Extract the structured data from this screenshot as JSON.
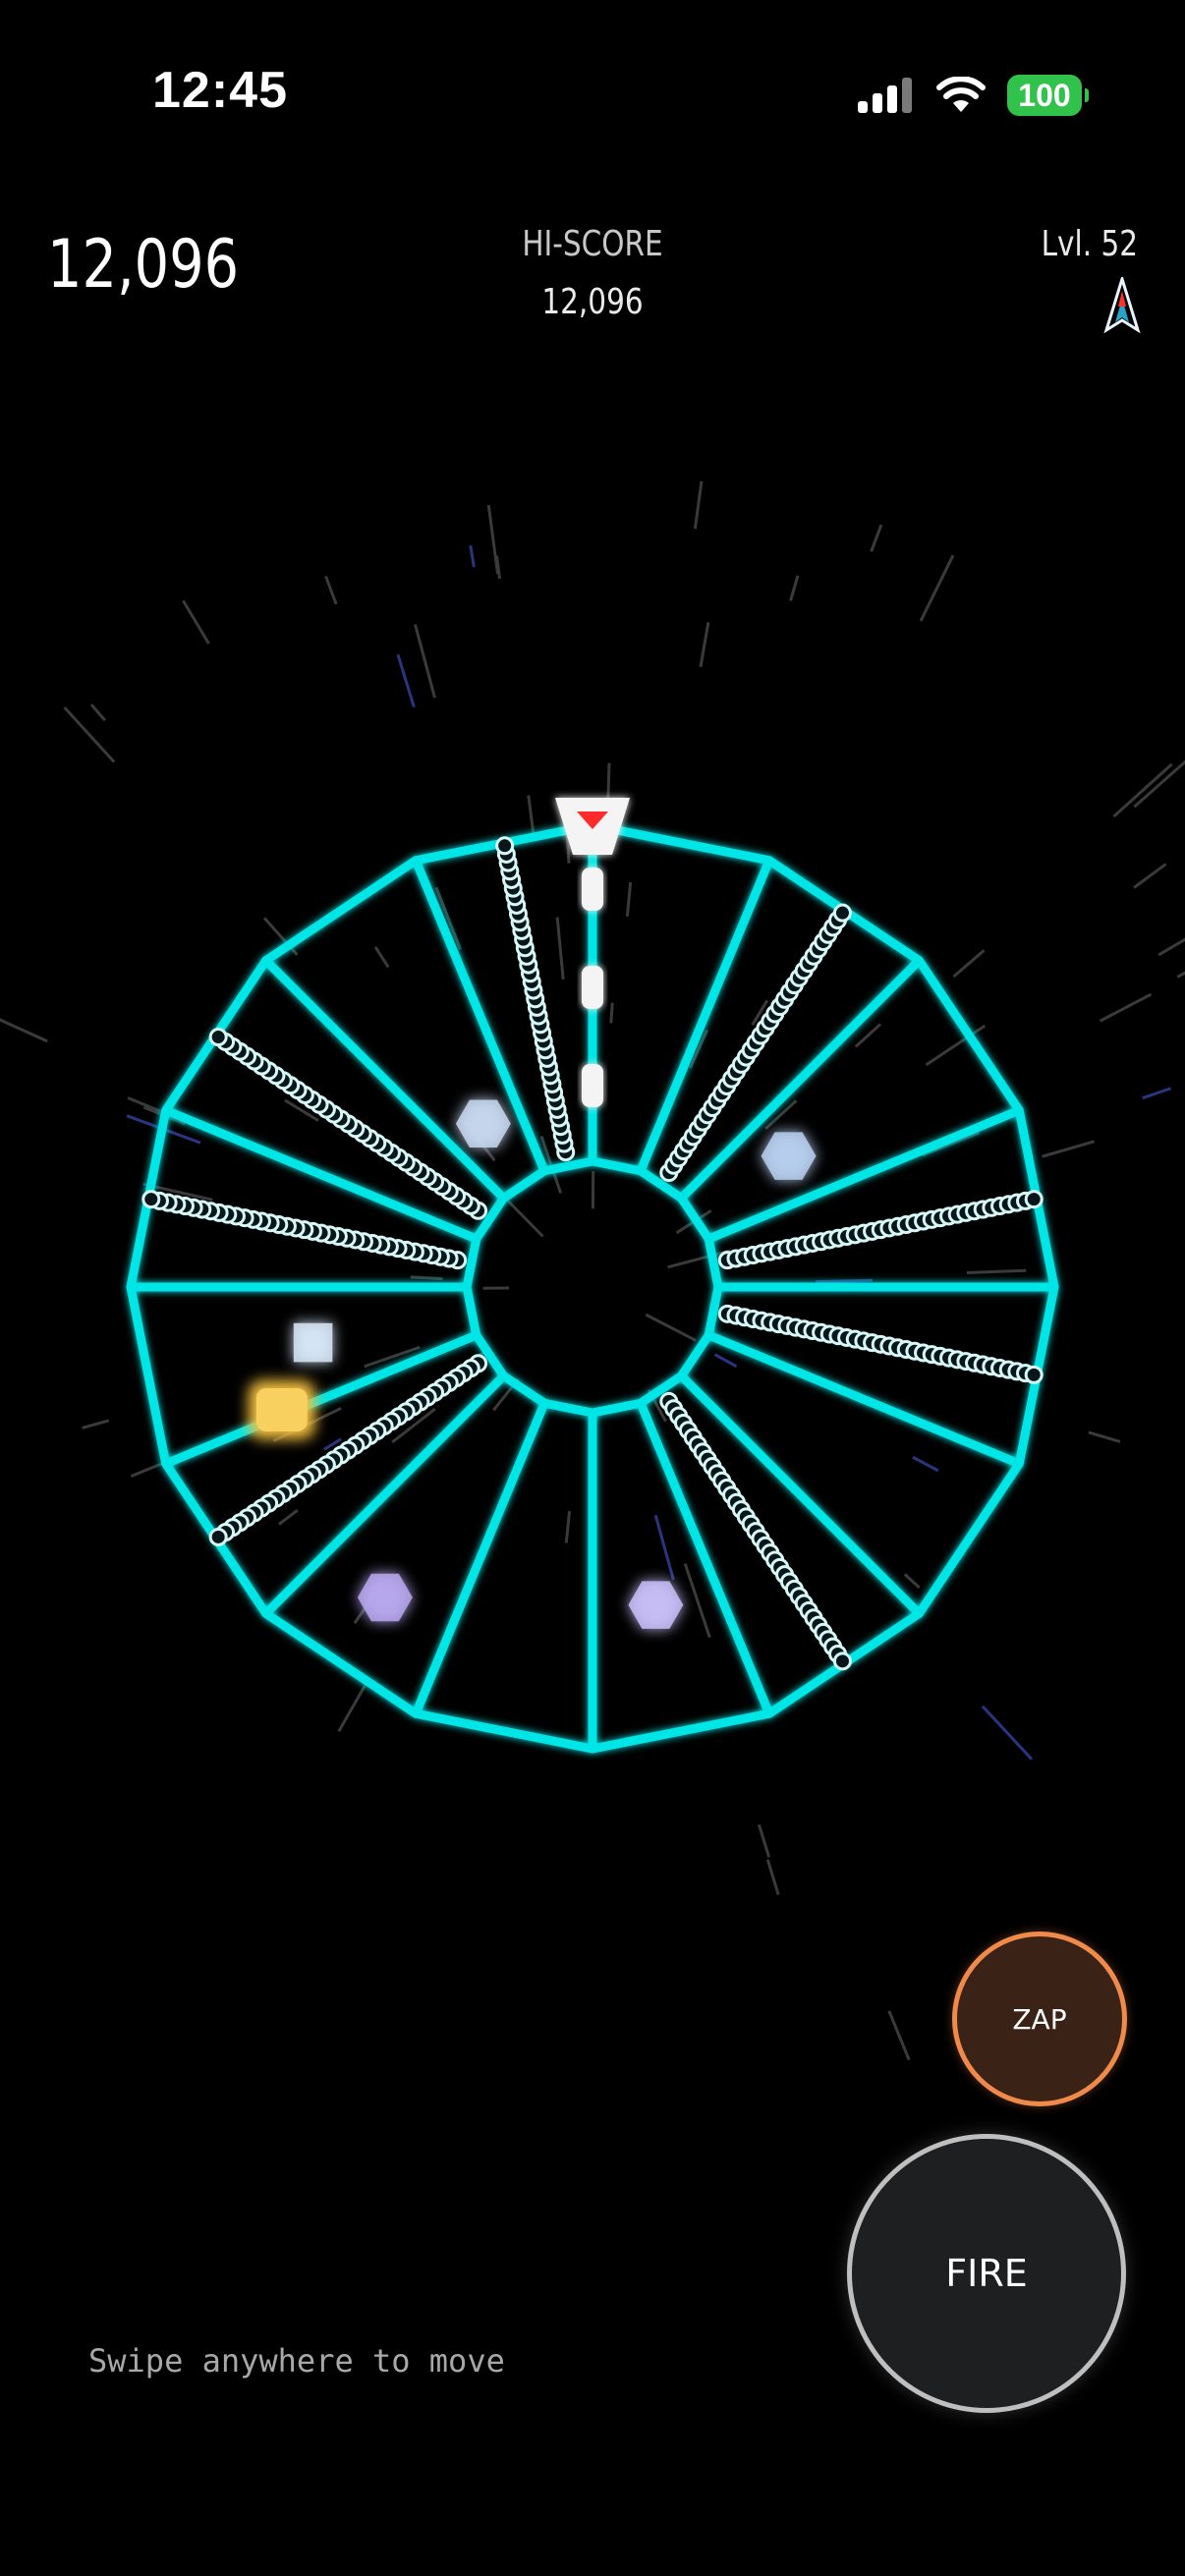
{
  "status_bar": {
    "time": "12:45",
    "battery_level": "100",
    "signal_icon": "cellular-signal-icon",
    "wifi_icon": "wifi-icon",
    "battery_color": "#30c24a"
  },
  "hud": {
    "score": "12,096",
    "hiscore_label": "HI-SCORE",
    "hiscore_value": "12,096",
    "level": "Lvl. 52",
    "lives_icon": "player-ship-icon"
  },
  "controls": {
    "zap_label": "ZAP",
    "fire_label": "FIRE",
    "zap_color": "#f08a4b"
  },
  "hint": "Swipe anywhere to move",
  "game": {
    "web_color": "#00e5e5",
    "lane_count": 16,
    "player_lane": 0,
    "spiker_lanes": [
      1,
      3,
      4,
      6,
      10,
      12,
      13,
      15
    ],
    "enemy_lanes": [
      2,
      7,
      9,
      11,
      14
    ],
    "player_color": "#ff2b2b"
  }
}
